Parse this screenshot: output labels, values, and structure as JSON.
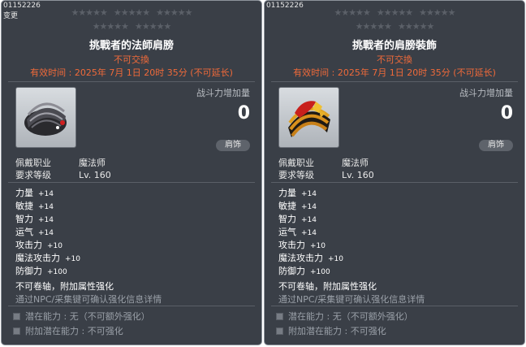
{
  "tooltips": [
    {
      "id": "01152226",
      "subtitle": "变更",
      "title": "挑戰者的法師肩膀",
      "untradable": "不可交換",
      "expiry": "有效时间 : 2025年 7月 1日 20时 35分 (不可延长)",
      "power_label": "战斗力增加量",
      "power_value": "0",
      "category": "肩饰",
      "req_job_label": "佩戴职业",
      "req_job": "魔法师",
      "req_level_label": "要求等级",
      "req_level": "Lv. 160",
      "stats": [
        {
          "name": "力量",
          "value": "+14"
        },
        {
          "name": "敏捷",
          "value": "+14"
        },
        {
          "name": "智力",
          "value": "+14"
        },
        {
          "name": "运气",
          "value": "+14"
        },
        {
          "name": "攻击力",
          "value": "+10"
        },
        {
          "name": "魔法攻击力",
          "value": "+10"
        },
        {
          "name": "防御力",
          "value": "+100"
        }
      ],
      "note1": "不可卷轴，附加属性强化",
      "note2": "通过NPC/采集键可确认强化信息详情",
      "potential": "潜在能力 : 无（不可额外强化）",
      "additional_potential": "附加潜在能力 : 不可强化",
      "icon": "dark-helmet-shoulder-icon"
    },
    {
      "id": "01152226",
      "subtitle": "",
      "title": "挑戰者的肩膀裝飾",
      "untradable": "不可交換",
      "expiry": "有效时间 : 2025年 7月 1日 20时 35分 (不可延长)",
      "power_label": "战斗力增加量",
      "power_value": "0",
      "category": "肩饰",
      "req_job_label": "佩戴职业",
      "req_job": "魔法师",
      "req_level_label": "要求等级",
      "req_level": "Lv. 160",
      "stats": [
        {
          "name": "力量",
          "value": "+14"
        },
        {
          "name": "敏捷",
          "value": "+14"
        },
        {
          "name": "智力",
          "value": "+14"
        },
        {
          "name": "运气",
          "value": "+14"
        },
        {
          "name": "攻击力",
          "value": "+10"
        },
        {
          "name": "魔法攻击力",
          "value": "+10"
        },
        {
          "name": "防御力",
          "value": "+100"
        }
      ],
      "note1": "不可卷轴，附加属性强化",
      "note2": "通过NPC/采集键可确认强化信息详情",
      "potential": "潜在能力 : 无（不可额外强化）",
      "additional_potential": "附加潜在能力 : 不可强化",
      "icon": "gold-red-shoulder-icon"
    }
  ],
  "colors": {
    "panel": "#3a3f47",
    "warning": "#f06a3a",
    "muted": "#9aa0a8"
  }
}
